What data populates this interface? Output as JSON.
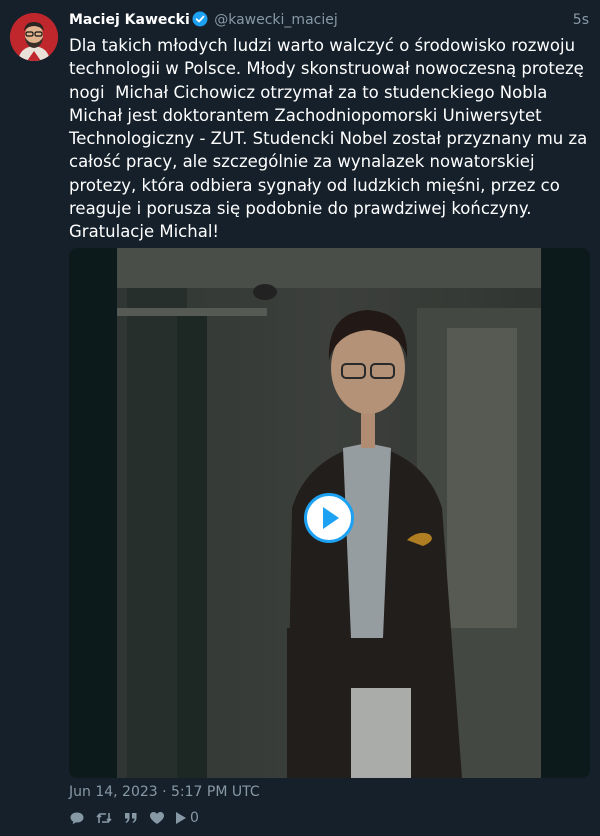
{
  "tweet": {
    "author_name": "Maciej Kawecki",
    "author_handle": "@kawecki_maciej",
    "relative_time": "5s",
    "text": "Dla takich młodych ludzi warto walczyć o środowisko rozwoju technologii w Polsce. Młody skonstruował nowoczesną protezę nogi  Michał Cichowicz otrzymał za to studenckiego Nobla     Michał jest doktorantem Zachodniopomorski Uniwersytet Technologiczny - ZUT. Studencki Nobel został przyznany mu za całość pracy, ale szczególnie za wynalazek nowatorskiej protezy, która odbiera sygnały od ludzkich mięśni, przez co reaguje i porusza się podobnie do prawdziwej kończyny. Gratulacje Michal!",
    "timestamp": "Jun 14, 2023 · 5:17 PM UTC",
    "view_count": "0"
  },
  "icons": {
    "verified": "verified-badge-icon",
    "play": "play-icon",
    "reply": "reply-icon",
    "retweet": "retweet-icon",
    "quote": "quote-icon",
    "like": "heart-icon",
    "views": "views-icon"
  },
  "colors": {
    "background": "#15202b",
    "text": "#ffffff",
    "muted": "#8899a6",
    "accent": "#1da1f2",
    "avatar_bg": "#c0272d"
  }
}
